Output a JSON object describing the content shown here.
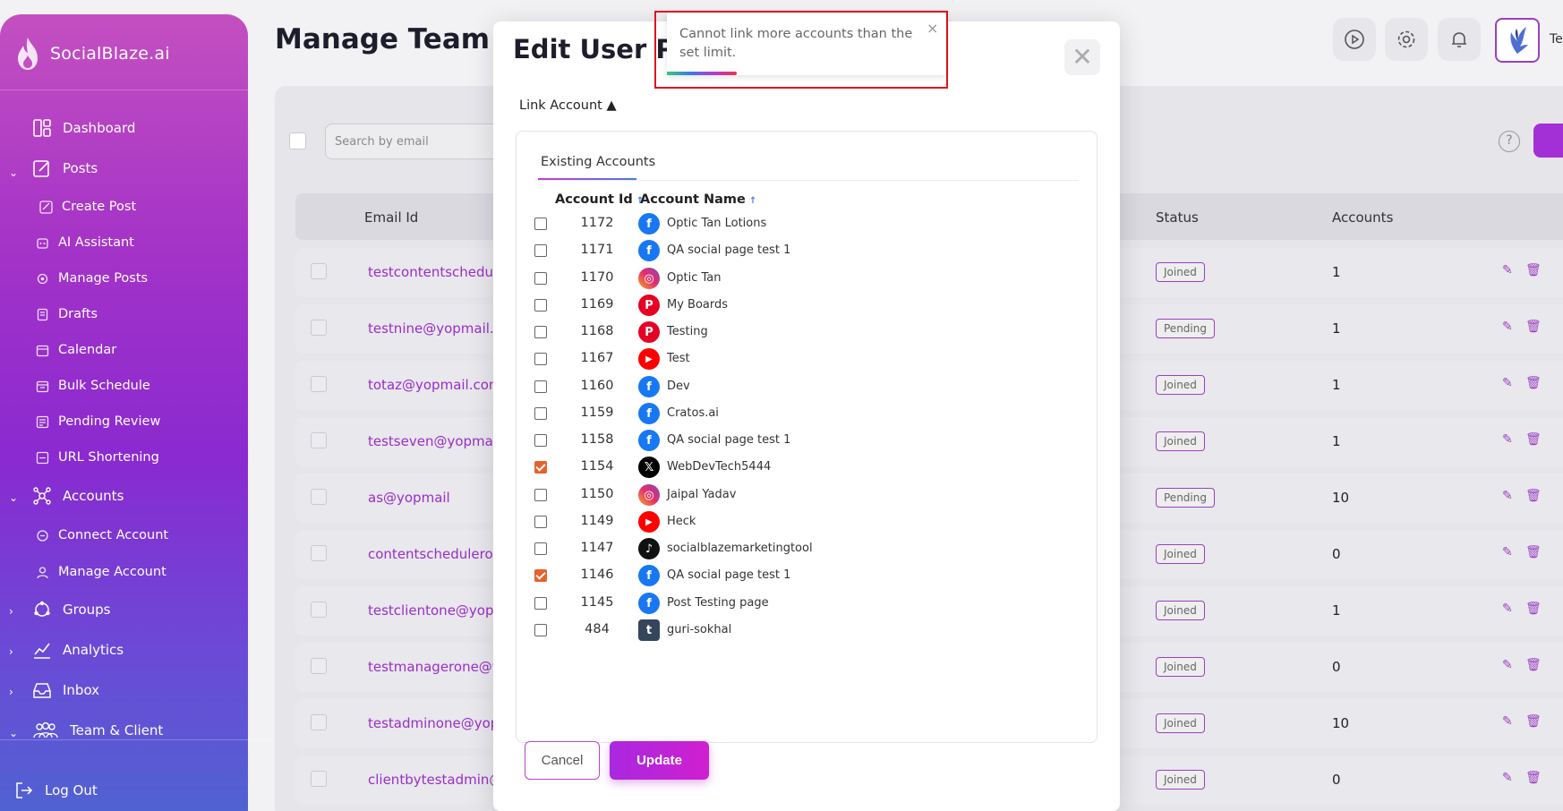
{
  "brand": {
    "name": "SocialBlaze.ai"
  },
  "sidebar": {
    "items": [
      {
        "label": "Dashboard",
        "icon": "dashboard-icon"
      },
      {
        "label": "Posts",
        "icon": "posts-icon"
      },
      {
        "label": "Create Post",
        "icon": "create-post-icon"
      },
      {
        "label": "AI Assistant",
        "icon": "ai-assistant-icon"
      },
      {
        "label": "Manage Posts",
        "icon": "manage-posts-icon"
      },
      {
        "label": "Drafts",
        "icon": "drafts-icon"
      },
      {
        "label": "Calendar",
        "icon": "calendar-icon"
      },
      {
        "label": "Bulk Schedule",
        "icon": "bulk-schedule-icon"
      },
      {
        "label": "Pending Review",
        "icon": "pending-review-icon"
      },
      {
        "label": "URL Shortening",
        "icon": "url-shortening-icon"
      },
      {
        "label": "Accounts",
        "icon": "accounts-icon"
      },
      {
        "label": "Connect Account",
        "icon": "connect-account-icon"
      },
      {
        "label": "Manage Account",
        "icon": "manage-account-icon"
      },
      {
        "label": "Groups",
        "icon": "groups-icon"
      },
      {
        "label": "Analytics",
        "icon": "analytics-icon"
      },
      {
        "label": "Inbox",
        "icon": "inbox-icon"
      },
      {
        "label": "Team & Client",
        "icon": "team-icon"
      }
    ],
    "logout": "Log Out"
  },
  "page": {
    "title": "Manage Team &",
    "header_text": "Te",
    "search_placeholder": "Search by email",
    "help": "?",
    "columns": {
      "email": "Email Id",
      "status": "Status",
      "accounts": "Accounts"
    },
    "rows": [
      {
        "email": "testcontentschedule",
        "status": "Joined",
        "accounts": "1"
      },
      {
        "email": "testnine@yopmail.c",
        "status": "Pending",
        "accounts": "1"
      },
      {
        "email": "totaz@yopmail.com",
        "status": "Joined",
        "accounts": "1"
      },
      {
        "email": "testseven@yopmail",
        "status": "Joined",
        "accounts": "1"
      },
      {
        "email": "as@yopmail",
        "status": "Pending",
        "accounts": "10"
      },
      {
        "email": "contentscheduleron",
        "status": "Joined",
        "accounts": "0"
      },
      {
        "email": "testclientone@yopn",
        "status": "Joined",
        "accounts": "1"
      },
      {
        "email": "testmanagerone@y",
        "status": "Joined",
        "accounts": "0"
      },
      {
        "email": "testadminone@yop",
        "status": "Joined",
        "accounts": "10"
      },
      {
        "email": "clientbytestadmin@",
        "status": "Joined",
        "accounts": "0"
      }
    ]
  },
  "modal": {
    "title": "Edit User Pe",
    "link_account": "Link Account ▲",
    "tab": "Existing Accounts",
    "col_id": "Account Id",
    "col_name": "Account Name",
    "sort_arrow": "↑",
    "cancel": "Cancel",
    "update": "Update",
    "close": "✕",
    "accounts": [
      {
        "id": "1172",
        "name": "Optic Tan Lotions",
        "platform": "facebook",
        "checked": false
      },
      {
        "id": "1171",
        "name": "QA social page test 1",
        "platform": "facebook",
        "checked": false
      },
      {
        "id": "1170",
        "name": "Optic Tan",
        "platform": "instagram",
        "checked": false
      },
      {
        "id": "1169",
        "name": "My Boards",
        "platform": "pinterest",
        "checked": false
      },
      {
        "id": "1168",
        "name": "Testing",
        "platform": "pinterest",
        "checked": false
      },
      {
        "id": "1167",
        "name": "Test",
        "platform": "youtube",
        "checked": false
      },
      {
        "id": "1160",
        "name": "Dev",
        "platform": "facebook",
        "checked": false
      },
      {
        "id": "1159",
        "name": "Cratos.ai",
        "platform": "facebook",
        "checked": false
      },
      {
        "id": "1158",
        "name": "QA social page test 1",
        "platform": "facebook",
        "checked": false
      },
      {
        "id": "1154",
        "name": "WebDevTech5444",
        "platform": "x",
        "checked": true
      },
      {
        "id": "1150",
        "name": "Jaipal Yadav",
        "platform": "instagram",
        "checked": false
      },
      {
        "id": "1149",
        "name": "Heck",
        "platform": "youtube",
        "checked": false
      },
      {
        "id": "1147",
        "name": "socialblazemarketingtool",
        "platform": "tiktok",
        "checked": false
      },
      {
        "id": "1146",
        "name": "QA social page test 1",
        "platform": "facebook",
        "checked": true
      },
      {
        "id": "1145",
        "name": "Post Testing page",
        "platform": "facebook",
        "checked": false
      },
      {
        "id": "484",
        "name": "guri-sokhal",
        "platform": "tumblr",
        "checked": false
      }
    ]
  },
  "toast": {
    "message": "Cannot link more accounts than the set limit.",
    "close": "×",
    "progress": 0.25
  },
  "colors": {
    "accent": "#a32fd6",
    "facebook": "#1877f2",
    "instagram": "#e1306c",
    "pinterest": "#e60023",
    "youtube": "#ff0000",
    "x": "#000000",
    "tiktok": "#111111",
    "tumblr": "#35465c",
    "checkbox_checked": "#e8612c"
  }
}
